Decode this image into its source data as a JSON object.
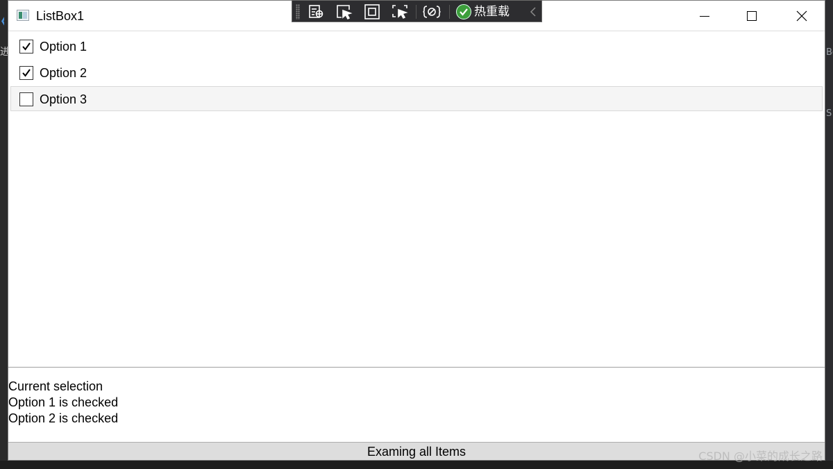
{
  "window": {
    "title": "ListBox1"
  },
  "debug_toolbar": {
    "icons": [
      "live-visual-tree-icon",
      "select-element-icon",
      "display-adorners-icon",
      "track-focus-icon",
      "binding-failures-icon"
    ],
    "hot_reload_label": "热重载"
  },
  "listbox": {
    "items": [
      {
        "label": "Option 1",
        "checked": true
      },
      {
        "label": "Option 2",
        "checked": true
      },
      {
        "label": "Option 3",
        "checked": false
      }
    ]
  },
  "status": {
    "lines": [
      "Current selection",
      "Option 1 is checked",
      "Option 2 is checked"
    ]
  },
  "button": {
    "label": "Examing all Items"
  },
  "watermark": "CSDN @小菜的成长之路",
  "background": {
    "left_glyph": "进",
    "right_glyphs": [
      "Bo",
      "S"
    ]
  },
  "colors": {
    "toolbar_bg": "#2d2d30",
    "hot_reload_green": "#3c9e3c",
    "button_bg": "#dddddd",
    "hover_bg": "#f5f5f5"
  }
}
